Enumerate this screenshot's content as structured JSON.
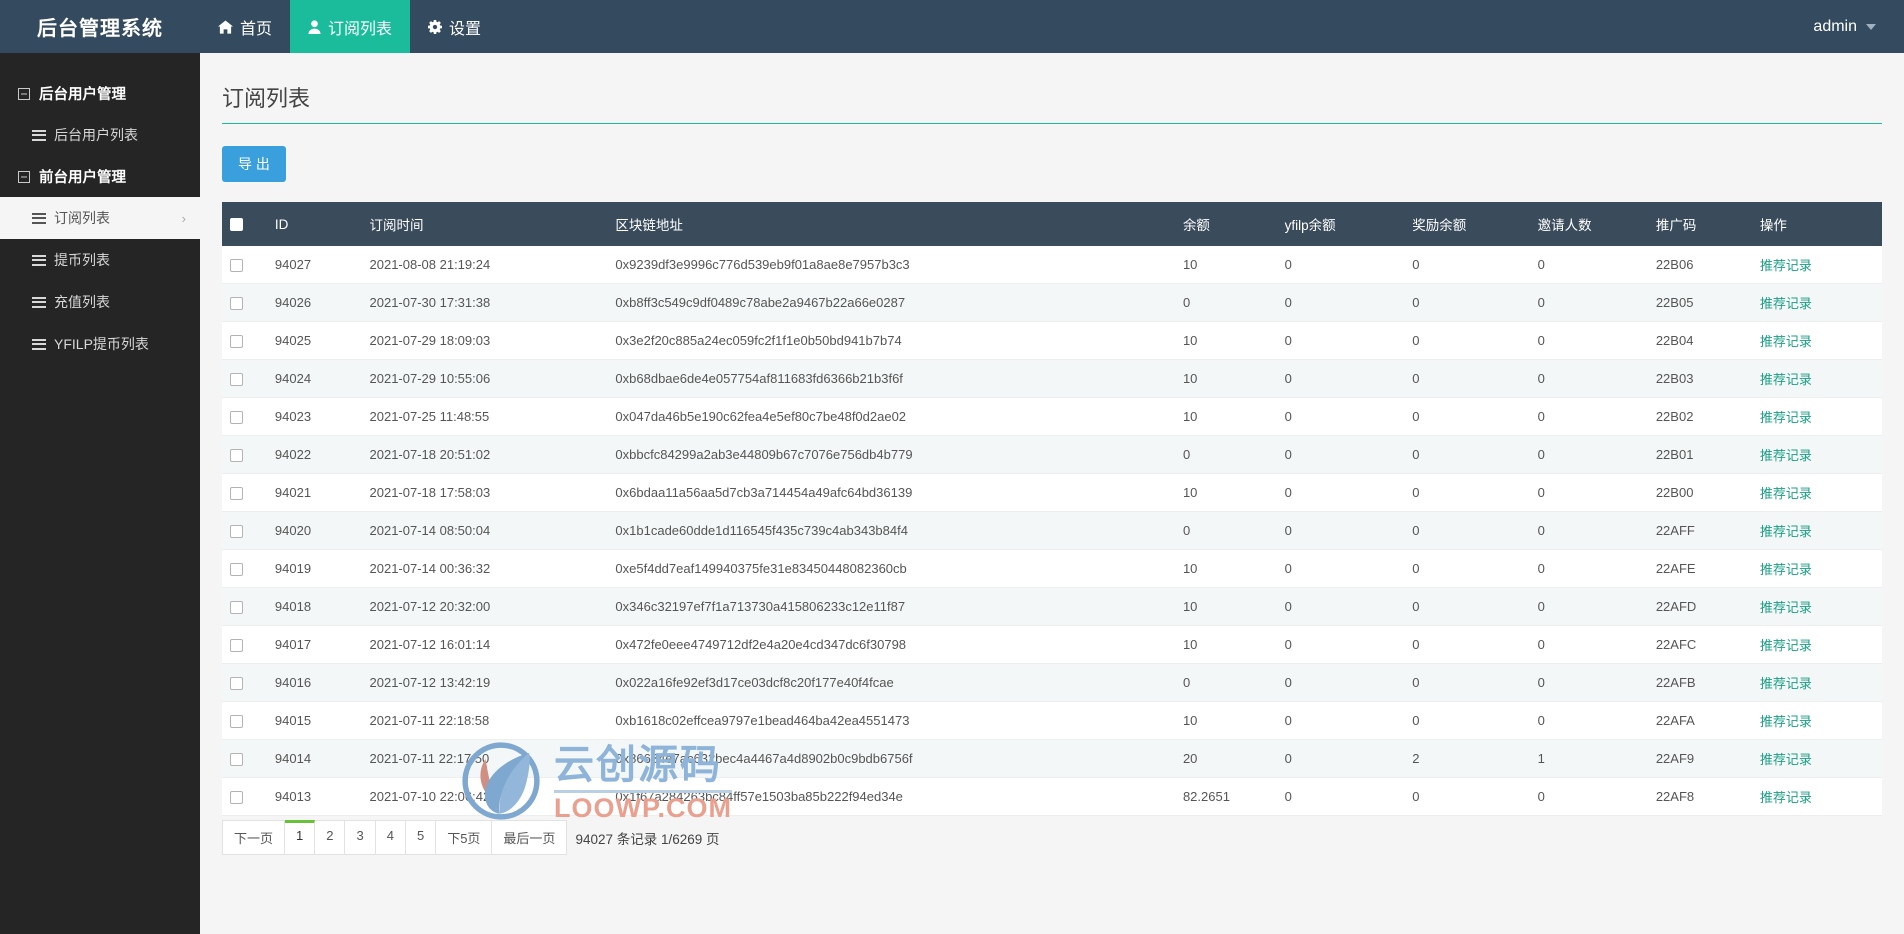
{
  "navbar": {
    "brand": "后台管理系统",
    "items": [
      {
        "label": "首页",
        "icon": "home-icon",
        "active": false
      },
      {
        "label": "订阅列表",
        "icon": "user-icon",
        "active": true
      },
      {
        "label": "设置",
        "icon": "gear-icon",
        "active": false
      }
    ],
    "user": "admin"
  },
  "sidebar": {
    "groups": [
      {
        "label": "后台用户管理",
        "icon": "minus-box-icon",
        "items": [
          {
            "label": "后台用户列表",
            "icon": "list-icon",
            "active": false
          }
        ]
      },
      {
        "label": "前台用户管理",
        "icon": "minus-box-icon",
        "items": [
          {
            "label": "订阅列表",
            "icon": "list-icon",
            "active": true,
            "chevron": "›"
          },
          {
            "label": "提币列表",
            "icon": "list-icon",
            "active": false
          },
          {
            "label": "充值列表",
            "icon": "list-icon",
            "active": false
          },
          {
            "label": "YFILP提币列表",
            "icon": "list-icon",
            "active": false
          }
        ]
      }
    ]
  },
  "page": {
    "title": "订阅列表",
    "export_label": "导 出"
  },
  "table": {
    "columns": [
      "ID",
      "订阅时间",
      "区块链地址",
      "余额",
      "yfilp余额",
      "奖励余额",
      "邀请人数",
      "推广码",
      "操作"
    ],
    "action_label": "推荐记录",
    "rows": [
      {
        "id": "94027",
        "time": "2021-08-08 21:19:24",
        "addr": "0x9239df3e9996c776d539eb9f01a8ae8e7957b3c3",
        "balance": "10",
        "yfilp": "0",
        "reward": "0",
        "invites": "0",
        "code": "22B06"
      },
      {
        "id": "94026",
        "time": "2021-07-30 17:31:38",
        "addr": "0xb8ff3c549c9df0489c78abe2a9467b22a66e0287",
        "balance": "0",
        "yfilp": "0",
        "reward": "0",
        "invites": "0",
        "code": "22B05"
      },
      {
        "id": "94025",
        "time": "2021-07-29 18:09:03",
        "addr": "0x3e2f20c885a24ec059fc2f1f1e0b50bd941b7b74",
        "balance": "10",
        "yfilp": "0",
        "reward": "0",
        "invites": "0",
        "code": "22B04"
      },
      {
        "id": "94024",
        "time": "2021-07-29 10:55:06",
        "addr": "0xb68dbae6de4e057754af811683fd6366b21b3f6f",
        "balance": "10",
        "yfilp": "0",
        "reward": "0",
        "invites": "0",
        "code": "22B03"
      },
      {
        "id": "94023",
        "time": "2021-07-25 11:48:55",
        "addr": "0x047da46b5e190c62fea4e5ef80c7be48f0d2ae02",
        "balance": "10",
        "yfilp": "0",
        "reward": "0",
        "invites": "0",
        "code": "22B02"
      },
      {
        "id": "94022",
        "time": "2021-07-18 20:51:02",
        "addr": "0xbbcfc84299a2ab3e44809b67c7076e756db4b779",
        "balance": "0",
        "yfilp": "0",
        "reward": "0",
        "invites": "0",
        "code": "22B01"
      },
      {
        "id": "94021",
        "time": "2021-07-18 17:58:03",
        "addr": "0x6bdaa11a56aa5d7cb3a714454a49afc64bd36139",
        "balance": "10",
        "yfilp": "0",
        "reward": "0",
        "invites": "0",
        "code": "22B00"
      },
      {
        "id": "94020",
        "time": "2021-07-14 08:50:04",
        "addr": "0x1b1cade60dde1d116545f435c739c4ab343b84f4",
        "balance": "0",
        "yfilp": "0",
        "reward": "0",
        "invites": "0",
        "code": "22AFF"
      },
      {
        "id": "94019",
        "time": "2021-07-14 00:36:32",
        "addr": "0xe5f4dd7eaf149940375fe31e83450448082360cb",
        "balance": "10",
        "yfilp": "0",
        "reward": "0",
        "invites": "0",
        "code": "22AFE"
      },
      {
        "id": "94018",
        "time": "2021-07-12 20:32:00",
        "addr": "0x346c32197ef7f1a713730a415806233c12e11f87",
        "balance": "10",
        "yfilp": "0",
        "reward": "0",
        "invites": "0",
        "code": "22AFD"
      },
      {
        "id": "94017",
        "time": "2021-07-12 16:01:14",
        "addr": "0x472fe0eee4749712df2e4a20e4cd347dc6f30798",
        "balance": "10",
        "yfilp": "0",
        "reward": "0",
        "invites": "0",
        "code": "22AFC"
      },
      {
        "id": "94016",
        "time": "2021-07-12 13:42:19",
        "addr": "0x022a16fe92ef3d17ce03dcf8c20f177e40f4fcae",
        "balance": "0",
        "yfilp": "0",
        "reward": "0",
        "invites": "0",
        "code": "22AFB"
      },
      {
        "id": "94015",
        "time": "2021-07-11 22:18:58",
        "addr": "0xb1618c02effcea9797e1bead464ba42ea4551473",
        "balance": "10",
        "yfilp": "0",
        "reward": "0",
        "invites": "0",
        "code": "22AFA"
      },
      {
        "id": "94014",
        "time": "2021-07-11 22:17:50",
        "addr": "0x86684e7ac632bec4a4467a4d8902b0c9bdb6756f",
        "balance": "20",
        "yfilp": "0",
        "reward": "2",
        "invites": "1",
        "code": "22AF9"
      },
      {
        "id": "94013",
        "time": "2021-07-10 22:06:42",
        "addr": "0x1f67a284263bc84ff57e1503ba85b222f94ed34e",
        "balance": "82.2651",
        "yfilp": "0",
        "reward": "0",
        "invites": "0",
        "code": "22AF8"
      }
    ]
  },
  "pagination": {
    "buttons": [
      {
        "label": "下一页",
        "current": false
      },
      {
        "label": "1",
        "current": true
      },
      {
        "label": "2",
        "current": false
      },
      {
        "label": "3",
        "current": false
      },
      {
        "label": "4",
        "current": false
      },
      {
        "label": "5",
        "current": false
      },
      {
        "label": "下5页",
        "current": false
      },
      {
        "label": "最后一页",
        "current": false
      }
    ],
    "info": "94027 条记录 1/6269 页"
  },
  "watermark": {
    "cn": "云创源码",
    "en": "LOOWP.COM"
  },
  "colors": {
    "navbar": "#344a5f",
    "accent_green": "#1abc9c",
    "sidebar": "#252525",
    "table_header": "#3a4b5c",
    "export_blue": "#3aa0dd",
    "link_green": "#1a9e84",
    "page_current": "#67c23a"
  }
}
